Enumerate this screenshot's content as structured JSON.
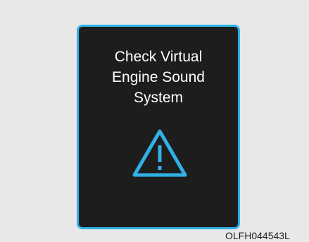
{
  "display": {
    "message_lines": [
      "Check Virtual",
      "Engine Sound",
      "System"
    ],
    "icon": "warning-triangle-icon",
    "accent_color": "#2fb2e6",
    "background_color": "#1d1d1d",
    "text_color": "#ffffff"
  },
  "figure": {
    "code": "OLFH044543L"
  }
}
